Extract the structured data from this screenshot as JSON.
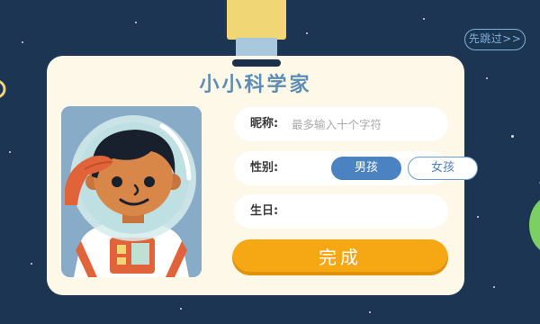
{
  "header": {
    "skip_label": "先跳过>>"
  },
  "card": {
    "title": "小小科学家"
  },
  "form": {
    "nickname": {
      "label": "昵称:",
      "value": "",
      "placeholder": "最多输入十个字符"
    },
    "gender": {
      "label": "性别:",
      "options": [
        "男孩",
        "女孩"
      ],
      "selected": "男孩"
    },
    "birthday": {
      "label": "生日:",
      "value": ""
    },
    "submit_label": "完成"
  },
  "colors": {
    "background": "#1c3553",
    "card": "#fdf8e8",
    "title": "#5d8db4",
    "accent_blue": "#4b82c1",
    "button_orange": "#f5a814"
  }
}
